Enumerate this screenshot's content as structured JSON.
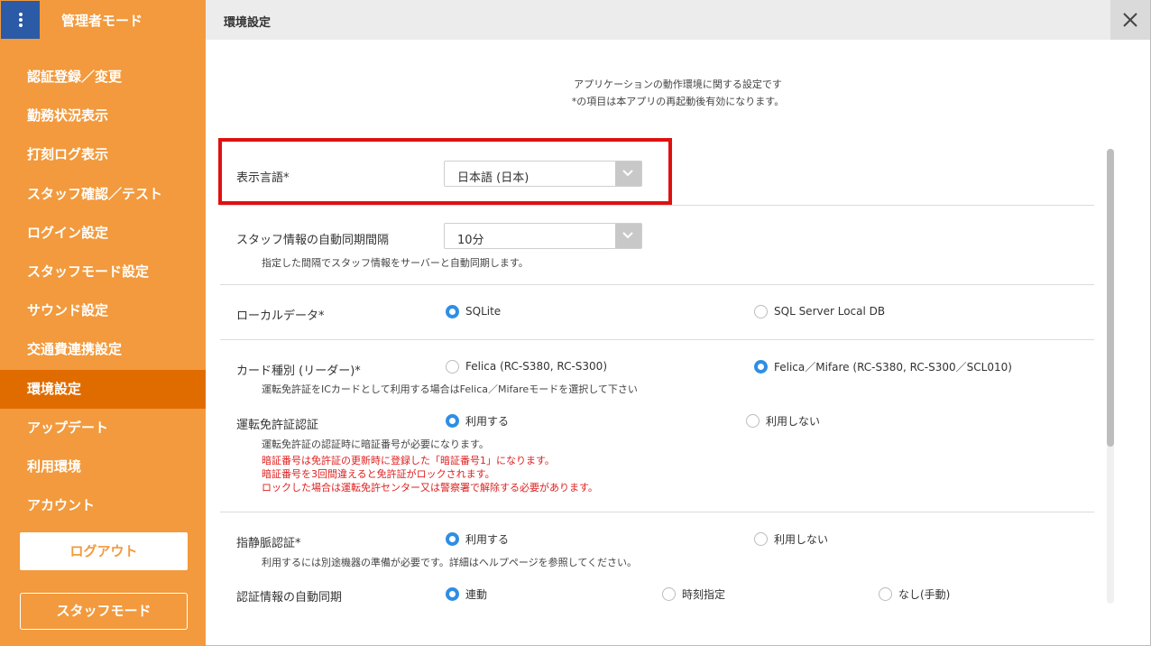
{
  "sidebar": {
    "title": "管理者モード",
    "items": [
      {
        "label": "認証登録／変更"
      },
      {
        "label": "勤務状況表示"
      },
      {
        "label": "打刻ログ表示"
      },
      {
        "label": "スタッフ確認／テスト"
      },
      {
        "label": "ログイン設定"
      },
      {
        "label": "スタッフモード設定"
      },
      {
        "label": "サウンド設定"
      },
      {
        "label": "交通費連携設定"
      },
      {
        "label": "環境設定"
      },
      {
        "label": "アップデート"
      },
      {
        "label": "利用環境"
      },
      {
        "label": "アカウント"
      }
    ],
    "active_index": 8,
    "logout_label": "ログアウト",
    "staff_mode_label": "スタッフモード"
  },
  "topbar": {
    "title": "環境設定",
    "close_icon": "close-icon"
  },
  "intro": {
    "line1": "アプリケーションの動作環境に関する設定です",
    "line2": "*の項目は本アプリの再起動後有効になります。"
  },
  "settings": {
    "language": {
      "label": "表示言語*",
      "value": "日本語 (日本)"
    },
    "sync": {
      "label": "スタッフ情報の自動同期間隔",
      "value": "10分",
      "hint": "指定した間隔でスタッフ情報をサーバーと自動同期します。"
    },
    "local_data": {
      "label": "ローカルデータ*",
      "opt1": "SQLite",
      "opt2": "SQL Server Local DB",
      "selected": 1
    },
    "card_type": {
      "label": "カード種別 (リーダー)*",
      "opt1": "Felica (RC-S380, RC-S300)",
      "opt2": "Felica／Mifare (RC-S380, RC-S300／SCL010)",
      "selected": 2,
      "hint": "運転免許証をICカードとして利用する場合はFelica／Mifareモードを選択して下さい"
    },
    "license_auth": {
      "label": "運転免許証認証",
      "opt1": "利用する",
      "opt2": "利用しない",
      "selected": 1,
      "hint": "運転免許証の認証時に暗証番号が必要になります。",
      "warn1": "暗証番号は免許証の更新時に登録した「暗証番号1」になります。",
      "warn2": "暗証番号を3回間違えると免許証がロックされます。",
      "warn3": "ロックした場合は運転免許センター又は警察署で解除する必要があります。"
    },
    "vein_auth": {
      "label": "指静脈認証*",
      "opt1": "利用する",
      "opt2": "利用しない",
      "selected": 1,
      "hint": "利用するには別途機器の準備が必要です。詳細はヘルプページを参照してください。"
    },
    "auth_sync": {
      "label": "認証情報の自動同期",
      "opt1": "連動",
      "opt2": "時刻指定",
      "opt3": "なし(手動)",
      "selected": 1
    }
  },
  "colors": {
    "sidebar": "#f29a3d",
    "active": "#e06c00",
    "kebab": "#2b5aa6",
    "highlight": "#e01010",
    "radio": "#2e8ee5",
    "warning": "#e02020"
  }
}
